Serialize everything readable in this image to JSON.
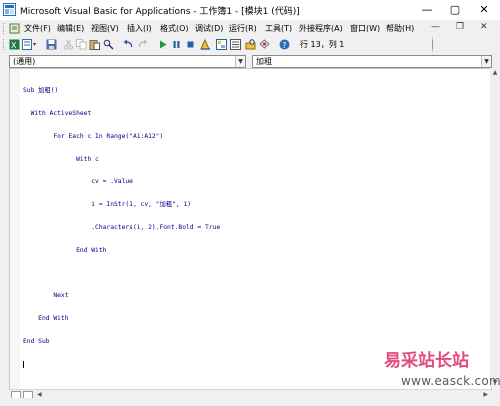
{
  "window": {
    "title": "Microsoft Visual Basic for Applications - 工作簿1 - [模块1 (代码)]",
    "controls": {
      "minimize": "—",
      "restore": "▢",
      "close": "✕"
    }
  },
  "menubar": {
    "items": [
      {
        "label": "文件(F)"
      },
      {
        "label": "编辑(E)"
      },
      {
        "label": "视图(V)"
      },
      {
        "label": "插入(I)"
      },
      {
        "label": "格式(O)"
      },
      {
        "label": "调试(D)"
      },
      {
        "label": "运行(R)"
      },
      {
        "label": "工具(T)"
      },
      {
        "label": "外接程序(A)"
      },
      {
        "label": "窗口(W)"
      },
      {
        "label": "帮助(H)"
      }
    ],
    "doc_controls": {
      "minimize": "—",
      "restore": "❐",
      "close": "✕"
    }
  },
  "toolbar": {
    "icons": [
      "excel-icon",
      "insert-module-icon",
      "cut-icon",
      "copy-icon",
      "paste-icon",
      "find-icon",
      "undo-icon",
      "redo-icon",
      "run-icon",
      "break-icon",
      "reset-icon",
      "design-mode-icon",
      "project-explorer-icon",
      "properties-icon",
      "object-browser-icon",
      "toolbox-icon",
      "help-icon"
    ],
    "position_text": "行 13，列 1"
  },
  "object_combo": {
    "value": "(通用)"
  },
  "procedure_combo": {
    "value": "加粗"
  },
  "code_lines": [
    "Sub 加粗()",
    "  With ActiveSheet",
    "        For Each c In Range(\"A1:A12\")",
    "              With c",
    "                  cv = .Value",
    "                  i = InStr(1, cv, \"加粗\", 1)",
    "                  .Characters(i, 2).Font.Bold = True",
    "              End With",
    "",
    "        Next",
    "    End With",
    "End Sub",
    ""
  ],
  "watermark": {
    "logo": "易采站长站",
    "url": "www.easck.com"
  },
  "colors": {
    "code_text": "#00008b",
    "watermark_logo": "#e34a7e"
  }
}
